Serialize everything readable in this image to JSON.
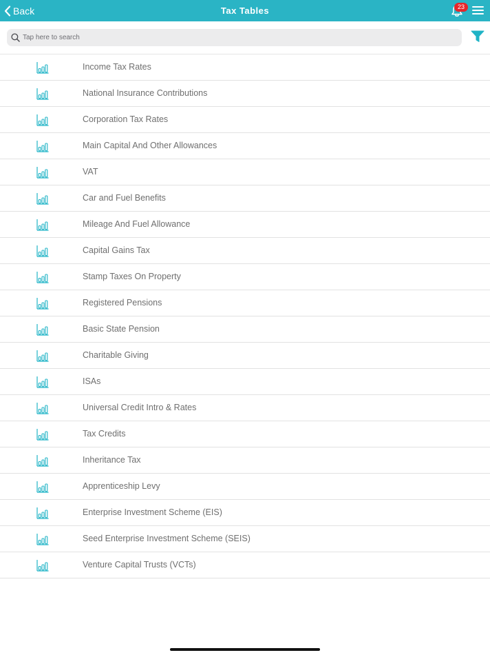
{
  "nav": {
    "back_label": "Back",
    "title": "Tax Tables",
    "notification_count": "23",
    "bar_color": "#2ab4c5"
  },
  "search": {
    "placeholder": "Tap here to search",
    "value": ""
  },
  "icons": {
    "back": "chevron-left-icon",
    "notifications": "bell-icon",
    "menu": "hamburger-menu-icon",
    "search": "search-icon",
    "filter": "filter-funnel-icon",
    "row": "bar-chart-icon"
  },
  "accent_color": "#1fb3c6",
  "items": [
    {
      "label": "Income Tax Rates"
    },
    {
      "label": "National Insurance Contributions"
    },
    {
      "label": "Corporation Tax Rates"
    },
    {
      "label": "Main Capital And Other Allowances"
    },
    {
      "label": "VAT"
    },
    {
      "label": "Car and Fuel Benefits"
    },
    {
      "label": "Mileage And Fuel Allowance"
    },
    {
      "label": "Capital Gains Tax"
    },
    {
      "label": "Stamp Taxes On Property"
    },
    {
      "label": "Registered Pensions"
    },
    {
      "label": "Basic State Pension"
    },
    {
      "label": "Charitable Giving"
    },
    {
      "label": "ISAs"
    },
    {
      "label": "Universal Credit Intro & Rates"
    },
    {
      "label": "Tax Credits"
    },
    {
      "label": "Inheritance Tax"
    },
    {
      "label": "Apprenticeship Levy"
    },
    {
      "label": "Enterprise Investment Scheme (EIS)"
    },
    {
      "label": "Seed Enterprise Investment Scheme (SEIS)"
    },
    {
      "label": "Venture Capital Trusts (VCTs)"
    }
  ]
}
